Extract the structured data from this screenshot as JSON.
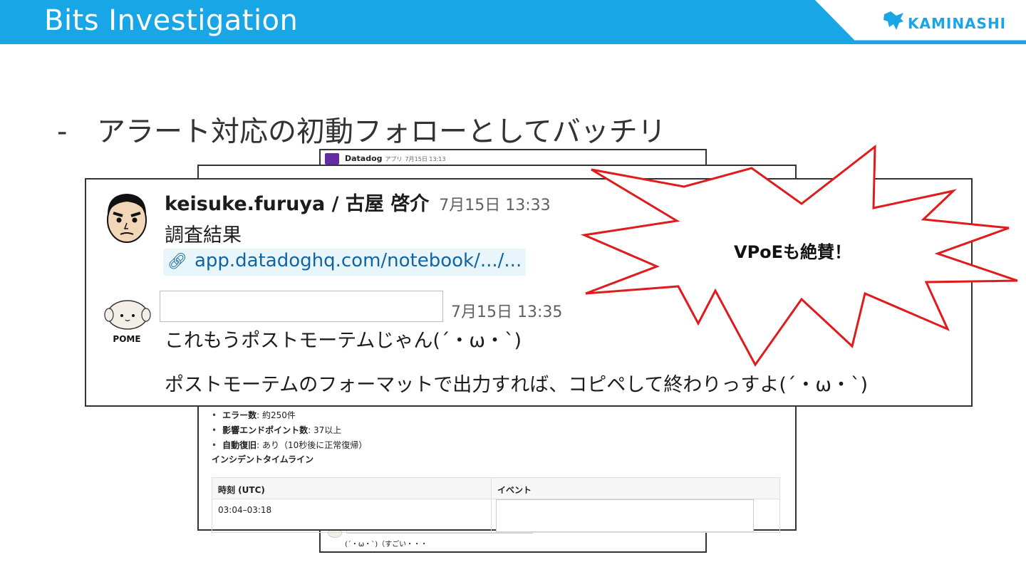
{
  "header": {
    "title": "Bits Investigation",
    "brand": "KAMINASHI",
    "colors": {
      "band": "#19a6e6",
      "brand_text": "#1aa5e6"
    }
  },
  "slide": {
    "bullet_dash": "-",
    "bullet_text": "アラート対応の初動フォローとしてバッチリ"
  },
  "back_thread": {
    "sender": "Datadog",
    "tag": "アプリ",
    "time": "7月15日 13:13",
    "reply": "(´・ω・`)（すごい・・・"
  },
  "report": {
    "items": [
      {
        "label": "エラー数",
        "value": ": 約250件"
      },
      {
        "label": "影響エンドポイント数",
        "value": ": 37以上"
      },
      {
        "label": "自動復旧",
        "value": ": あり（10秒後に正常復帰）"
      }
    ],
    "section_title": "インシデントタイムライン",
    "table": {
      "headers": [
        "時刻 (UTC)",
        "イベント"
      ],
      "rows": [
        [
          "03:04–03:18",
          ""
        ]
      ]
    }
  },
  "slack": {
    "msg1": {
      "author": "keisuke.furuya / 古屋 啓介",
      "time": "7月15日 13:33",
      "text": "調査結果",
      "link": "app.datadoghq.com/notebook/.../..."
    },
    "msg2": {
      "avatar_label": "POME",
      "time": "7月15日 13:35",
      "line1": "これもうポストモーテムじゃん(´・ω・`)",
      "line2": "ポストモーテムのフォーマットで出力すれば、コピペして終わりっすよ(´・ω・`)"
    }
  },
  "callout": {
    "text": "VPoEも絶賛！",
    "stroke_color": "#e01b1b"
  }
}
